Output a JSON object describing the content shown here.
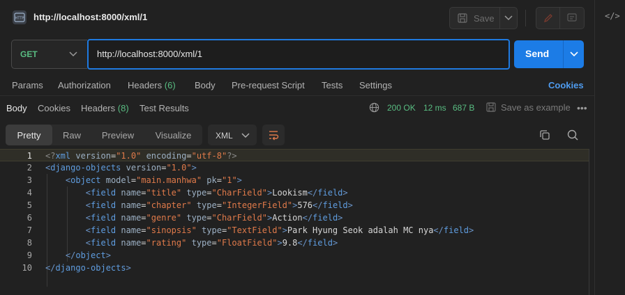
{
  "header": {
    "title": "http://localhost:8000/xml/1",
    "save_label": "Save"
  },
  "request": {
    "method": "GET",
    "url": "http://localhost:8000/xml/1",
    "send_label": "Send"
  },
  "request_tabs": {
    "params": "Params",
    "authorization": "Authorization",
    "headers": "Headers",
    "headers_count": "(6)",
    "body": "Body",
    "prerequest": "Pre-request Script",
    "tests": "Tests",
    "settings": "Settings",
    "cookies": "Cookies"
  },
  "response_tabs": {
    "body": "Body",
    "cookies": "Cookies",
    "headers": "Headers",
    "headers_count": "(8)",
    "test_results": "Test Results"
  },
  "status": {
    "code": "200 OK",
    "time": "12 ms",
    "size": "687 B",
    "save_example": "Save as example"
  },
  "toolbar": {
    "views": [
      "Pretty",
      "Raw",
      "Preview",
      "Visualize"
    ],
    "active_view": "Pretty",
    "format": "XML"
  },
  "code": {
    "line_numbers": [
      "1",
      "2",
      "3",
      "4",
      "5",
      "6",
      "7",
      "8",
      "9",
      "10"
    ],
    "xml_version": "1.0",
    "encoding": "utf-8",
    "root_tag": "django-objects",
    "root_version": "1.0",
    "object_tag": "object",
    "model": "main.manhwa",
    "pk": "1",
    "field_tag": "field",
    "fields": [
      {
        "name": "title",
        "type": "CharField",
        "value": "Lookism"
      },
      {
        "name": "chapter",
        "type": "IntegerField",
        "value": "576"
      },
      {
        "name": "genre",
        "type": "CharField",
        "value": "Action"
      },
      {
        "name": "sinopsis",
        "type": "TextField",
        "value": "Park Hyung Seok adalah MC nya"
      },
      {
        "name": "rating",
        "type": "FloatField",
        "value": "9.8"
      }
    ]
  },
  "colors": {
    "accent": "#1c7ce6",
    "success": "#59bd82",
    "link": "#4f9cf0",
    "xml_string": "#e07a4a",
    "xml_tag": "#5f9de0"
  }
}
